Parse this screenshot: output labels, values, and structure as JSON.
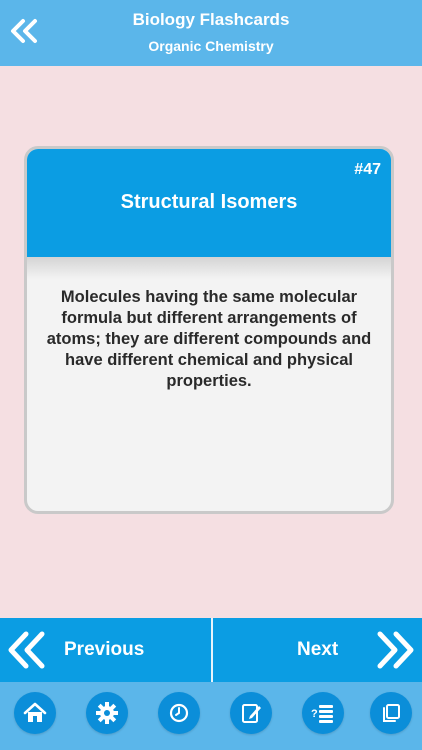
{
  "header": {
    "title": "Biology Flashcards",
    "subtitle": "Organic Chemistry"
  },
  "card": {
    "number": "#47",
    "title": "Structural Isomers",
    "definition": "Molecules having the same molecular formula but different arrangements of atoms; they are different compounds and have different chemical and physical properties."
  },
  "navigation": {
    "previous_label": "Previous",
    "next_label": "Next"
  },
  "toolbar": {
    "icons": [
      "home-icon",
      "gear-icon",
      "clock-icon",
      "note-edit-icon",
      "quiz-list-icon",
      "copy-cards-icon"
    ]
  },
  "colors": {
    "header": "#5bb6ea",
    "accent": "#0b9de3",
    "background": "#f5dfe2",
    "card": "#f3f3f3"
  }
}
